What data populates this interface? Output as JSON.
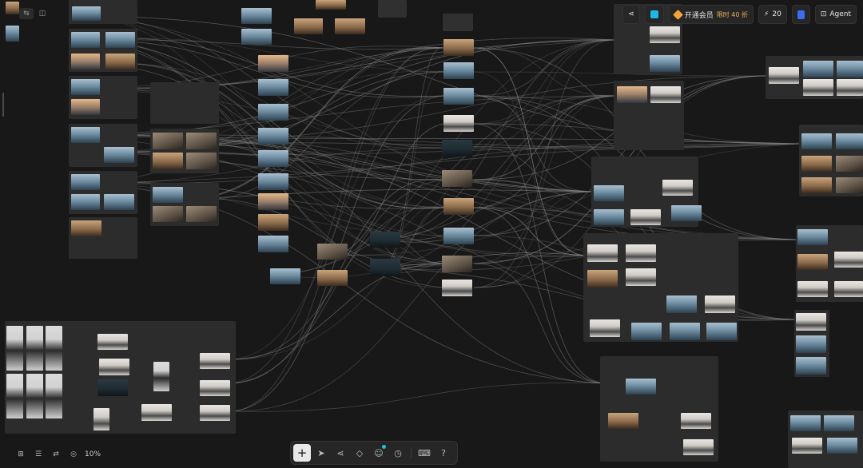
{
  "topbar": {
    "share_icon": "share-icon",
    "layers_icon": "layers-icon",
    "vip_label": "开通会员",
    "vip_tag": "限时 40 折",
    "credits": "20",
    "agent_label": "Agent"
  },
  "bottom_left": {
    "zoom": "10%"
  },
  "colors": {
    "canvas_bg": "#181818",
    "group_bg": "#2c2c2c",
    "wire": "#8a8a8a",
    "accent_cyan": "#1fb6e8",
    "accent_gold": "#e6b15a"
  }
}
